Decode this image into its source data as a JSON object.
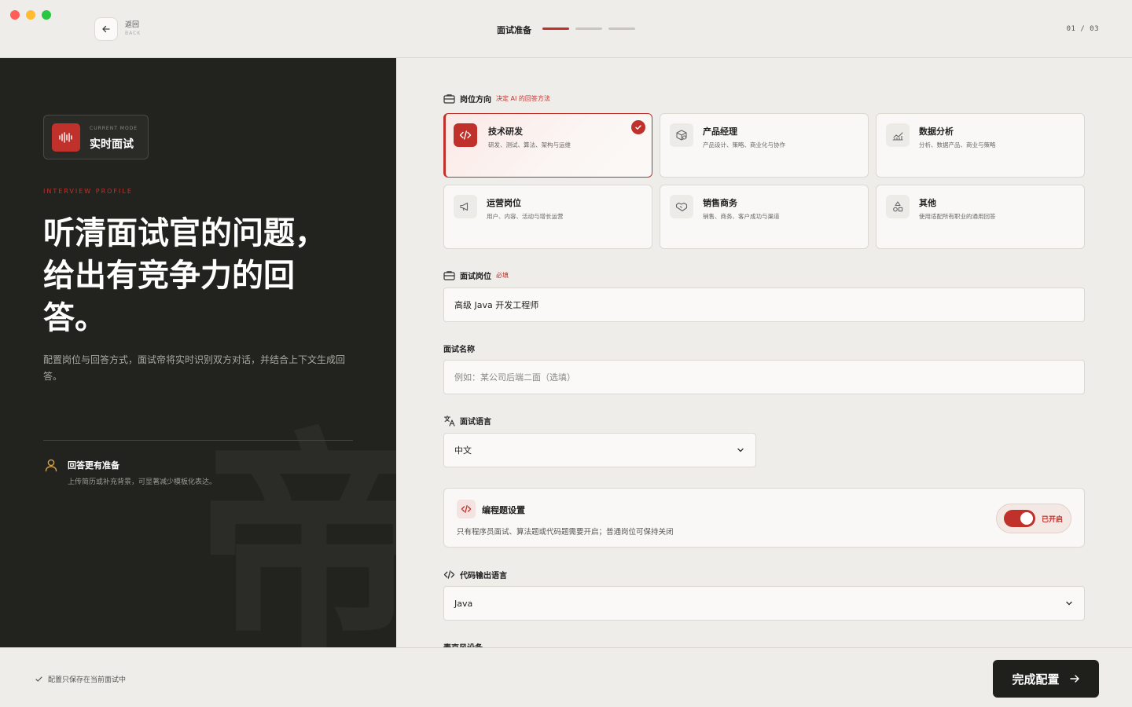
{
  "titlebar": {
    "back_label": "返回",
    "back_sub": "BACK",
    "step_title": "面试准备",
    "step_counter": "01 / 03",
    "steps_total": 3,
    "steps_active": 1
  },
  "left": {
    "mode_sub": "CURRENT MODE",
    "mode_name": "实时面试",
    "profile_label": "INTERVIEW PROFILE",
    "headline": "听清面试官的问题，给出有竞争力的回答。",
    "description": "配置岗位与回答方式，面试帝将实时识别双方对话，并结合上下文生成回答。",
    "feature_title": "回答更有准备",
    "feature_desc": "上传简历或补充背景，可显著减少模板化表达。",
    "watermark": "帝"
  },
  "direction": {
    "label": "岗位方向",
    "hint": "决定 AI 的回答方法",
    "cards": [
      {
        "title": "技术研发",
        "desc": "研发、测试、算法、架构与运维",
        "icon": "code-icon",
        "selected": true
      },
      {
        "title": "产品经理",
        "desc": "产品设计、策略、商业化与协作",
        "icon": "box-search-icon",
        "selected": false
      },
      {
        "title": "数据分析",
        "desc": "分析、数据产品、商业与策略",
        "icon": "chart-icon",
        "selected": false
      },
      {
        "title": "运营岗位",
        "desc": "用户、内容、活动与增长运营",
        "icon": "megaphone-icon",
        "selected": false
      },
      {
        "title": "销售商务",
        "desc": "销售、商务、客户成功与渠道",
        "icon": "handshake-icon",
        "selected": false
      },
      {
        "title": "其他",
        "desc": "使用适配所有职业的通用回答",
        "icon": "shapes-icon",
        "selected": false
      }
    ]
  },
  "position": {
    "label": "面试岗位",
    "required": "必填",
    "value": "高级 Java 开发工程师"
  },
  "interview_name": {
    "label": "面试名称",
    "placeholder": "例如：某公司后端二面（选填）"
  },
  "language": {
    "label": "面试语言",
    "value": "中文"
  },
  "coding": {
    "title": "编程题设置",
    "desc": "只有程序员面试、算法题或代码题需要开启；普通岗位可保持关闭",
    "toggle_label": "已开启",
    "enabled": true
  },
  "code_language": {
    "label": "代码输出语言",
    "value": "Java"
  },
  "mic": {
    "label": "麦克风设备"
  },
  "bottom": {
    "save_note": "配置只保存在当前面试中",
    "finish_label": "完成配置"
  },
  "colors": {
    "accent": "#c0312b",
    "dark_panel": "#22231f",
    "background": "#efedea"
  }
}
